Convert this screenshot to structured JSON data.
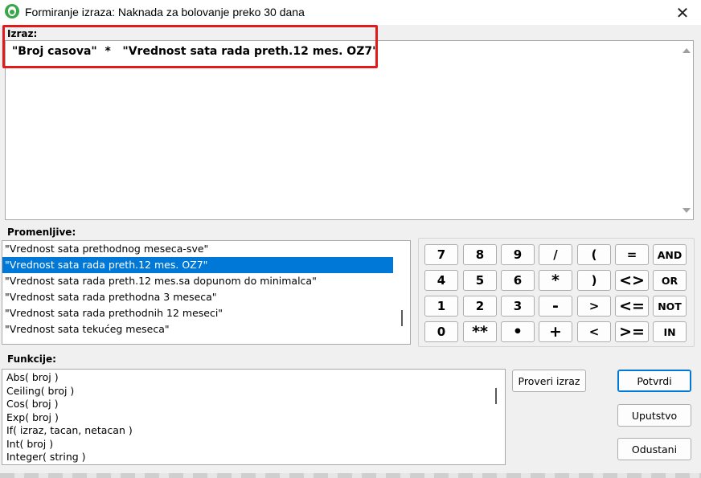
{
  "window": {
    "title": "Formiranje izraza: Naknada za bolovanje preko 30 dana",
    "close_label": "✕"
  },
  "expression": {
    "label": "Izraz:",
    "value": "\"Broj casova\"  *   \"Vrednost sata rada preth.12 mes. OZ7\""
  },
  "variables": {
    "label": "Promenljive:",
    "items": [
      "\"Vrednost sata prethodnog meseca-sve\"",
      "\"Vrednost sata rada preth.12 mes. OZ7\"",
      "\"Vrednost sata rada preth.12 mes.sa dopunom do minimalca\"",
      "\"Vrednost sata rada prethodna 3 meseca\"",
      "\"Vrednost sata rada prethodnih 12 meseci\"",
      "\"Vrednost sata tekućeg meseca\""
    ],
    "selected_index": 1
  },
  "keypad": {
    "rows": [
      [
        "7",
        "8",
        "9",
        "/",
        "(",
        "=",
        "AND"
      ],
      [
        "4",
        "5",
        "6",
        "*",
        ")",
        "<>",
        "OR"
      ],
      [
        "1",
        "2",
        "3",
        "-",
        ">",
        "<=",
        "NOT"
      ],
      [
        "0",
        "**",
        "•",
        "+",
        "<",
        ">=",
        "IN"
      ]
    ]
  },
  "functions": {
    "label": "Funkcije:",
    "items": [
      "Abs( broj )",
      "Ceiling( broj )",
      "Cos( broj )",
      "Exp( broj )",
      "If( izraz, tacan, netacan )",
      "Int( broj )",
      "Integer( string )"
    ]
  },
  "buttons": {
    "check": "Proveri izraz",
    "confirm": "Potvrdi",
    "help": "Uputstvo",
    "cancel": "Odustani"
  },
  "colors": {
    "selection": "#0078d7",
    "highlight": "#e31a1a",
    "app_icon": "#3aa64a"
  }
}
